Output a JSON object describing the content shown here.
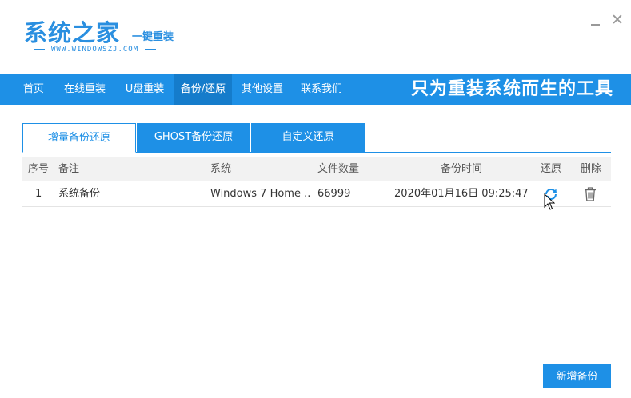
{
  "logo": {
    "title": "系统之家",
    "subtitle": "一键重装",
    "url": "WWW.WINDOWSZJ.COM"
  },
  "window": {
    "close_label": "✕"
  },
  "nav": {
    "items": [
      {
        "label": "首页"
      },
      {
        "label": "在线重装"
      },
      {
        "label": "U盘重装"
      },
      {
        "label": "备份/还原"
      },
      {
        "label": "其他设置"
      },
      {
        "label": "联系我们"
      }
    ],
    "active_index": 3,
    "slogan": "只为重装系统而生的工具"
  },
  "tabs": [
    {
      "label": "增量备份还原"
    },
    {
      "label": "GHOST备份还原"
    },
    {
      "label": "自定义还原"
    }
  ],
  "table": {
    "headers": {
      "index": "序号",
      "note": "备注",
      "system": "系统",
      "file_count": "文件数量",
      "backup_time": "备份时间",
      "restore": "还原",
      "delete": "删除"
    },
    "rows": [
      {
        "index": "1",
        "note": "系统备份",
        "system": "Windows 7 Home ...",
        "file_count": "66999",
        "backup_time": "2020年01月16日 09:25:47",
        "restore_icon": "refresh-icon",
        "delete_icon": "trash-icon"
      }
    ]
  },
  "buttons": {
    "new_backup": "新增备份"
  },
  "colors": {
    "accent": "#1e90e6",
    "accent_dark": "#157ccb",
    "header_bg": "#f2f2f2"
  }
}
